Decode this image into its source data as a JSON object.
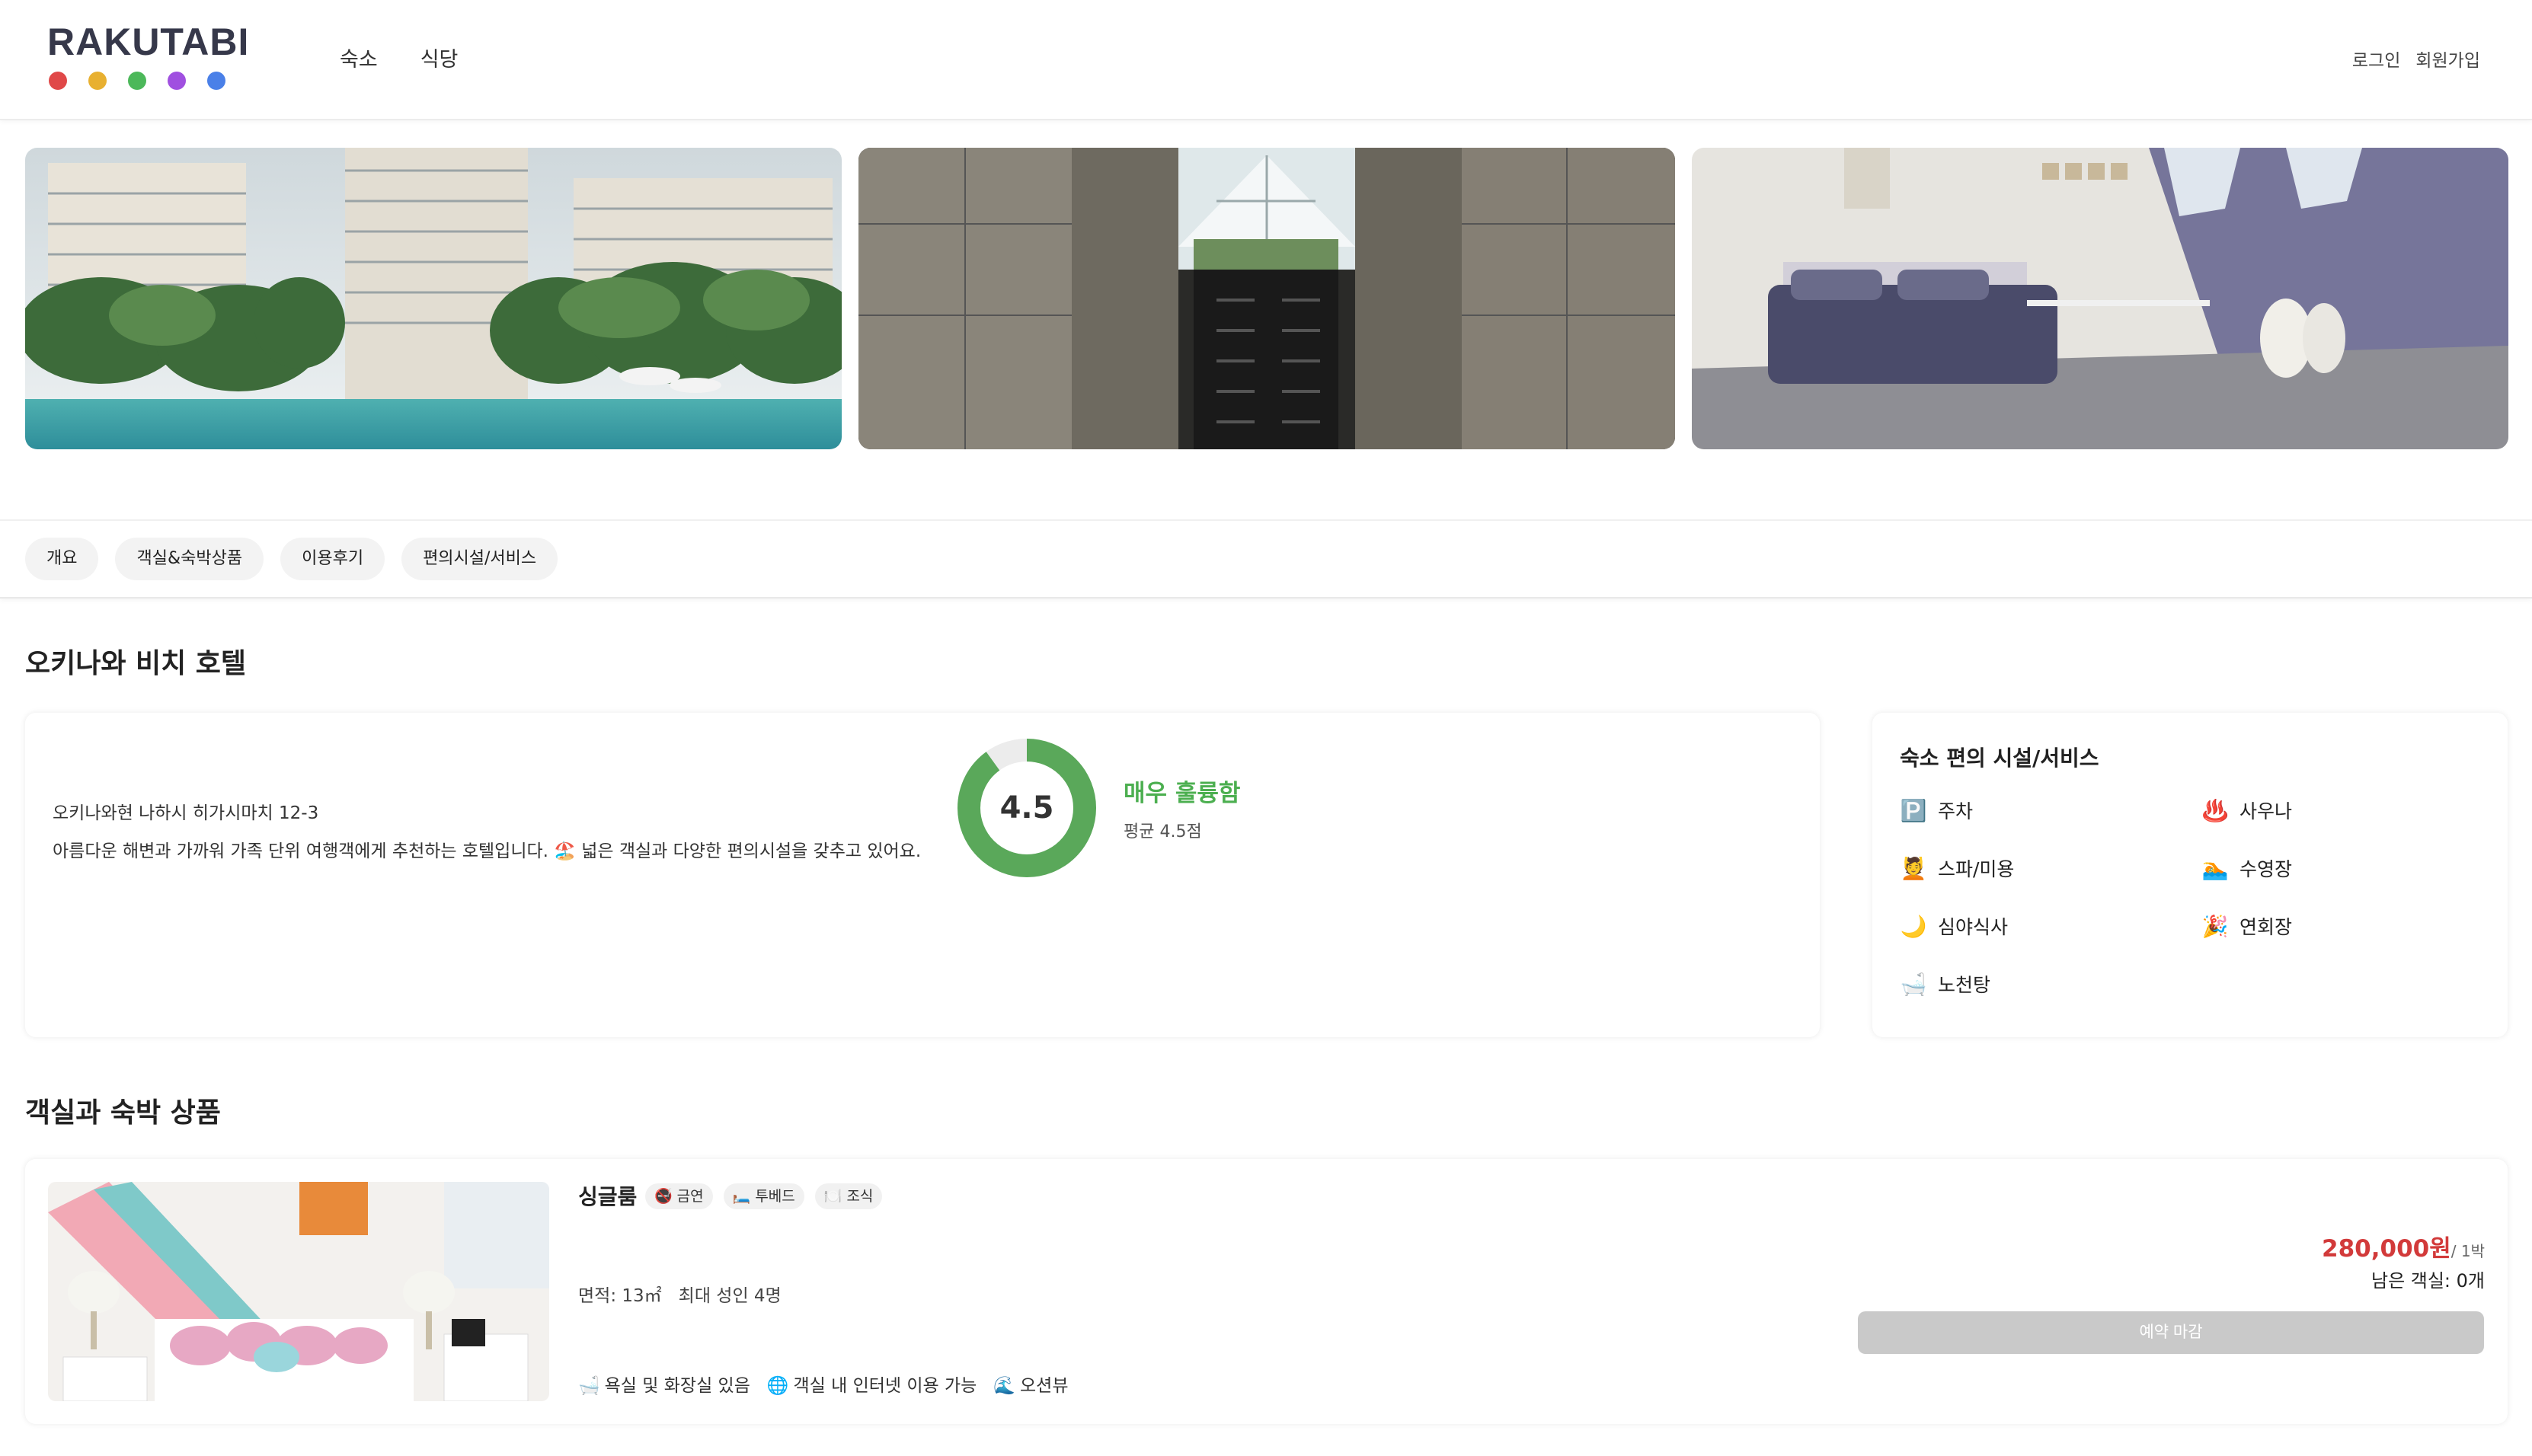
{
  "header": {
    "logo": "RAKUTABI",
    "logo_dots": [
      "#e04848",
      "#e8b030",
      "#4cb85a",
      "#a050e0",
      "#4a80e8"
    ],
    "nav": [
      "숙소",
      "식당"
    ],
    "auth": {
      "login": "로그인",
      "signup": "회원가입"
    }
  },
  "gallery": [
    "resort-pool-photo",
    "escalator-atrium-photo",
    "attic-bedroom-photo"
  ],
  "tabs": [
    "개요",
    "객실&숙박상품",
    "이용후기",
    "편의시설/서비스"
  ],
  "hotel": {
    "name": "오키나와 비치 호텔",
    "address": "오키나와현 나하시 히가시마치 12-3",
    "description": "아름다운 해변과 가까워 가족 단위 여행객에게 추천하는 호텔입니다. 🏖️ 넓은 객실과 다양한 편의시설을 갖추고 있어요.",
    "rating": {
      "score": "4.5",
      "value": 4.5,
      "max": 5,
      "label": "매우 훌륭함",
      "sub": "평균 4.5점",
      "color": "#5aa85a"
    }
  },
  "facilities": {
    "title": "숙소 편의 시설/서비스",
    "items": [
      {
        "icon": "🅿️",
        "icon_name": "parking-icon",
        "label": "주차"
      },
      {
        "icon": "♨️",
        "icon_name": "sauna-icon",
        "label": "사우나"
      },
      {
        "icon": "💆",
        "icon_name": "spa-icon",
        "label": "스파/미용"
      },
      {
        "icon": "🏊",
        "icon_name": "pool-icon",
        "label": "수영장"
      },
      {
        "icon": "🌙",
        "icon_name": "moon-icon",
        "label": "심야식사"
      },
      {
        "icon": "🎉",
        "icon_name": "party-icon",
        "label": "연회장"
      },
      {
        "icon": "🛁",
        "icon_name": "bath-icon",
        "label": "노천탕"
      }
    ]
  },
  "rooms_section": {
    "title": "객실과 숙박 상품"
  },
  "room": {
    "name": "싱글룸",
    "badges": [
      {
        "icon": "🚭",
        "icon_name": "no-smoking-icon",
        "label": "금연"
      },
      {
        "icon": "🛏️",
        "icon_name": "bed-icon",
        "label": "투베드"
      },
      {
        "icon": "🍽️",
        "icon_name": "breakfast-icon",
        "label": "조식"
      }
    ],
    "area": "면적: 13㎡",
    "capacity": "최대 성인 4명",
    "amenities": [
      {
        "icon": "🛁",
        "icon_name": "bathroom-icon",
        "label": "욕실 및 화장실 있음"
      },
      {
        "icon": "🌐",
        "icon_name": "internet-icon",
        "label": "객실 내 인터넷 이용 가능"
      },
      {
        "icon": "🌊",
        "icon_name": "ocean-icon",
        "label": "오션뷰"
      }
    ],
    "price": "280,000원",
    "per": "/ 1박",
    "remaining": "남은 객실: 0개",
    "button": "예약 마감"
  }
}
